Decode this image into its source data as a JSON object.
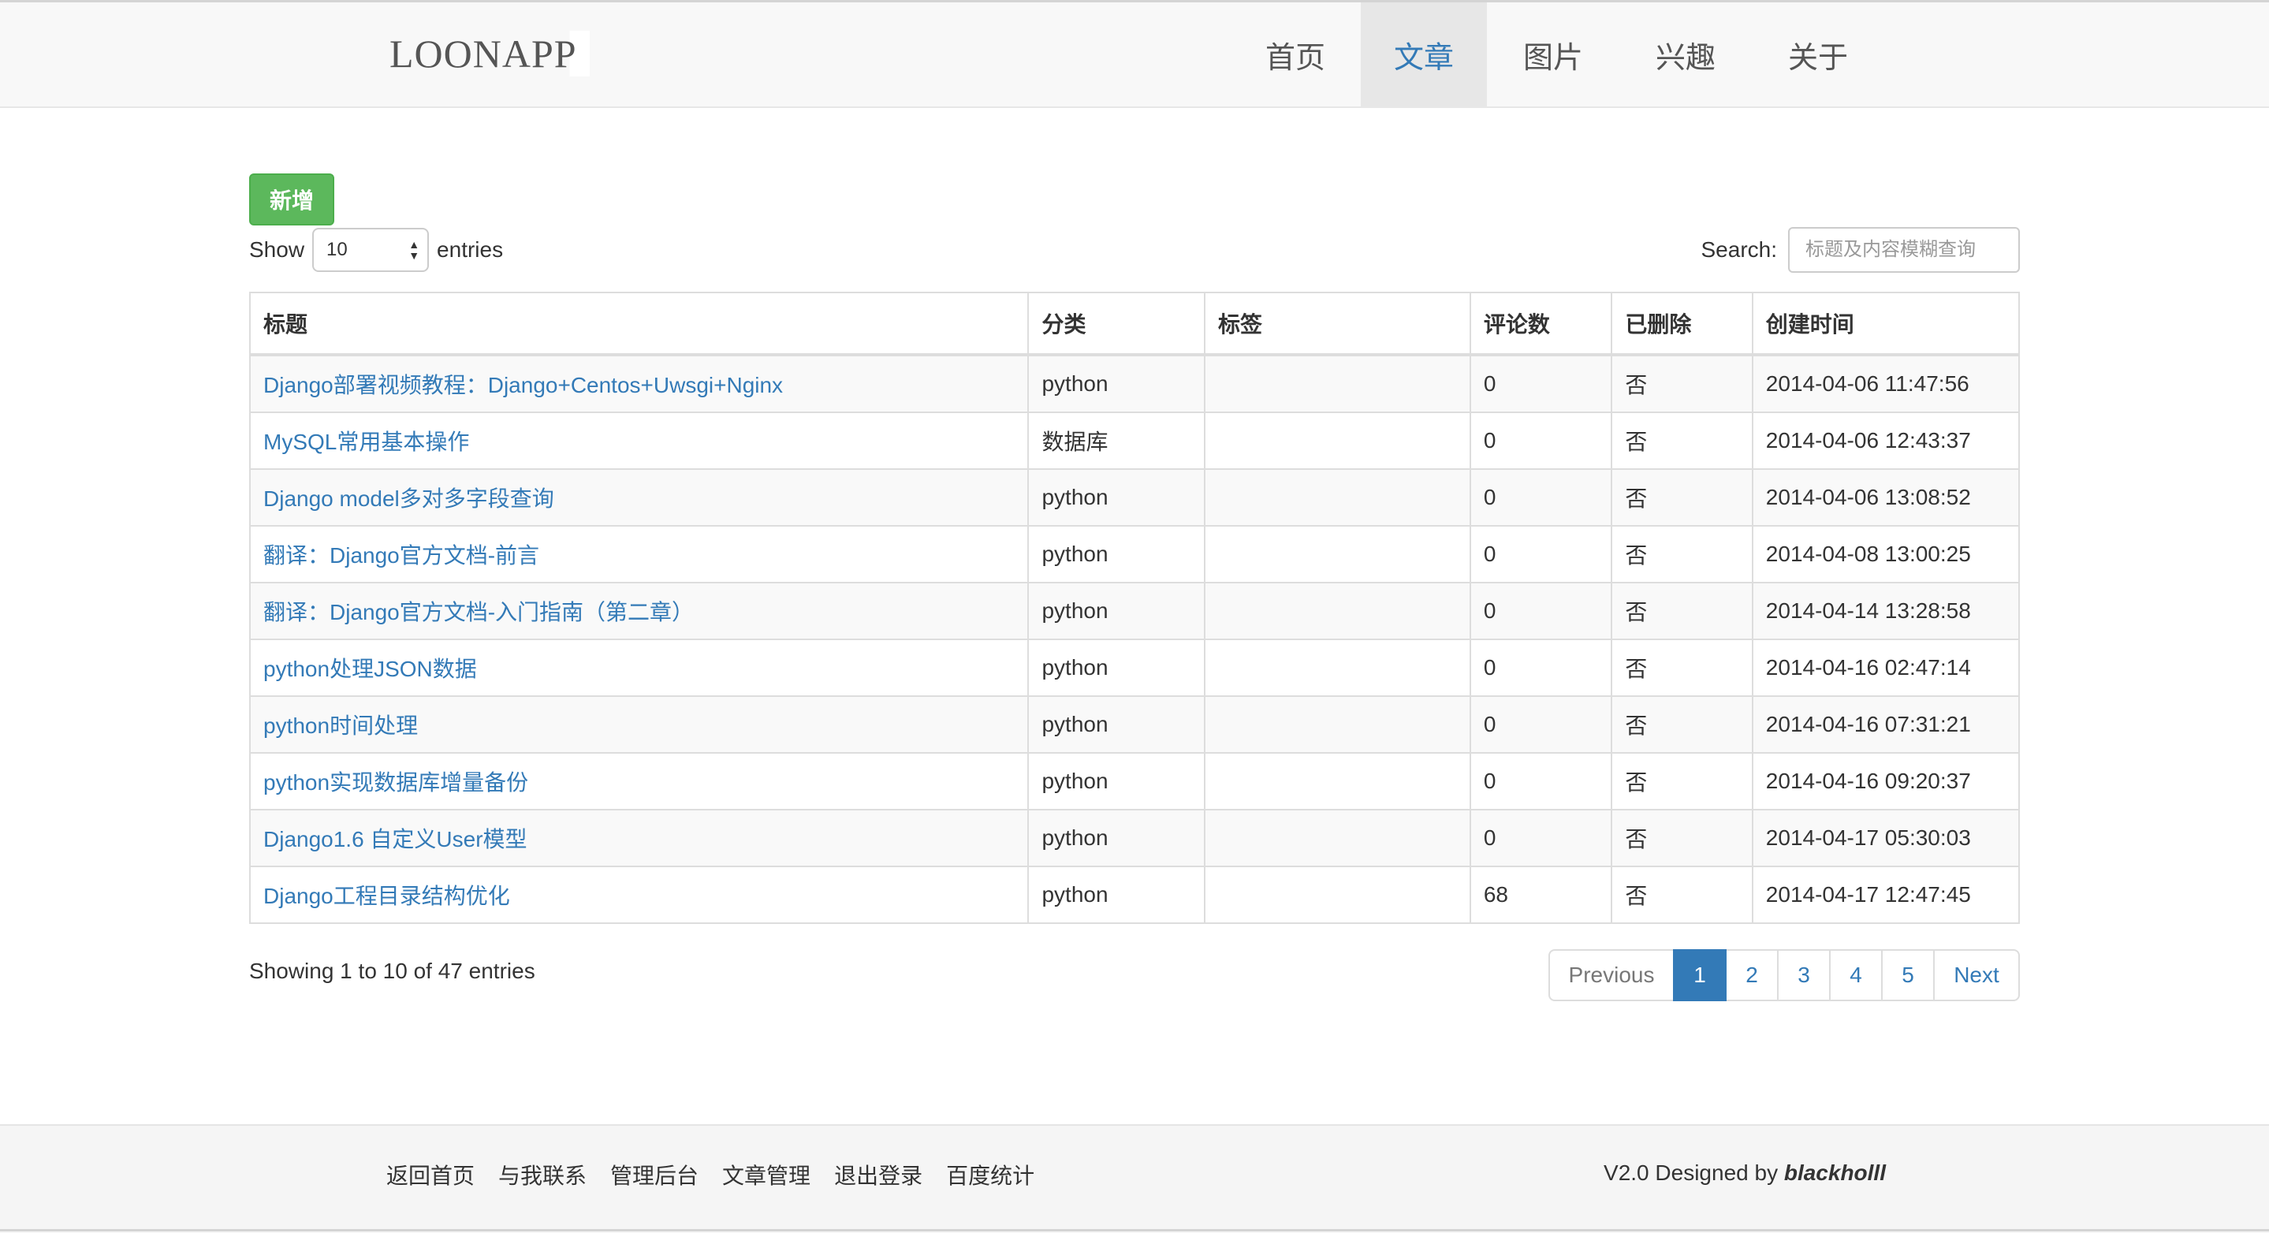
{
  "navbar": {
    "brand": "LOONAPP",
    "items": [
      {
        "label": "首页",
        "active": false
      },
      {
        "label": "文章",
        "active": true
      },
      {
        "label": "图片",
        "active": false
      },
      {
        "label": "兴趣",
        "active": false
      },
      {
        "label": "关于",
        "active": false
      }
    ]
  },
  "toolbar": {
    "add_label": "新增",
    "show_label": "Show",
    "page_length": "10",
    "entries_label": "entries",
    "search_label": "Search:",
    "search_placeholder": "标题及内容模糊查询",
    "search_value": ""
  },
  "table": {
    "headers": [
      "标题",
      "分类",
      "标签",
      "评论数",
      "已删除",
      "创建时间"
    ],
    "rows": [
      {
        "title": "Django部署视频教程：Django+Centos+Uwsgi+Nginx",
        "category": "python",
        "tags": "",
        "comments": "0",
        "deleted": "否",
        "created": "2014-04-06 11:47:56"
      },
      {
        "title": "MySQL常用基本操作",
        "category": "数据库",
        "tags": "",
        "comments": "0",
        "deleted": "否",
        "created": "2014-04-06 12:43:37"
      },
      {
        "title": "Django model多对多字段查询",
        "category": "python",
        "tags": "",
        "comments": "0",
        "deleted": "否",
        "created": "2014-04-06 13:08:52"
      },
      {
        "title": "翻译：Django官方文档-前言",
        "category": "python",
        "tags": "",
        "comments": "0",
        "deleted": "否",
        "created": "2014-04-08 13:00:25"
      },
      {
        "title": "翻译：Django官方文档-入门指南（第二章）",
        "category": "python",
        "tags": "",
        "comments": "0",
        "deleted": "否",
        "created": "2014-04-14 13:28:58"
      },
      {
        "title": "python处理JSON数据",
        "category": "python",
        "tags": "",
        "comments": "0",
        "deleted": "否",
        "created": "2014-04-16 02:47:14"
      },
      {
        "title": "python时间处理",
        "category": "python",
        "tags": "",
        "comments": "0",
        "deleted": "否",
        "created": "2014-04-16 07:31:21"
      },
      {
        "title": "python实现数据库增量备份",
        "category": "python",
        "tags": "",
        "comments": "0",
        "deleted": "否",
        "created": "2014-04-16 09:20:37"
      },
      {
        "title": "Django1.6 自定义User模型",
        "category": "python",
        "tags": "",
        "comments": "0",
        "deleted": "否",
        "created": "2014-04-17 05:30:03"
      },
      {
        "title": "Django工程目录结构优化",
        "category": "python",
        "tags": "",
        "comments": "68",
        "deleted": "否",
        "created": "2014-04-17 12:47:45"
      }
    ]
  },
  "info": "Showing 1 to 10 of 47 entries",
  "pagination": {
    "previous": "Previous",
    "pages": [
      "1",
      "2",
      "3",
      "4",
      "5"
    ],
    "current": "1",
    "next": "Next"
  },
  "footer": {
    "links": [
      "返回首页",
      "与我联系",
      "管理后台",
      "文章管理",
      "退出登录",
      "百度统计"
    ],
    "credit_prefix": "V2.0 Designed by ",
    "credit_author": "blackholll"
  },
  "colors": {
    "accent": "#337ab7",
    "success": "#5cb85c",
    "navbar_bg": "#f8f8f8",
    "footer_bg": "#f5f5f5"
  }
}
